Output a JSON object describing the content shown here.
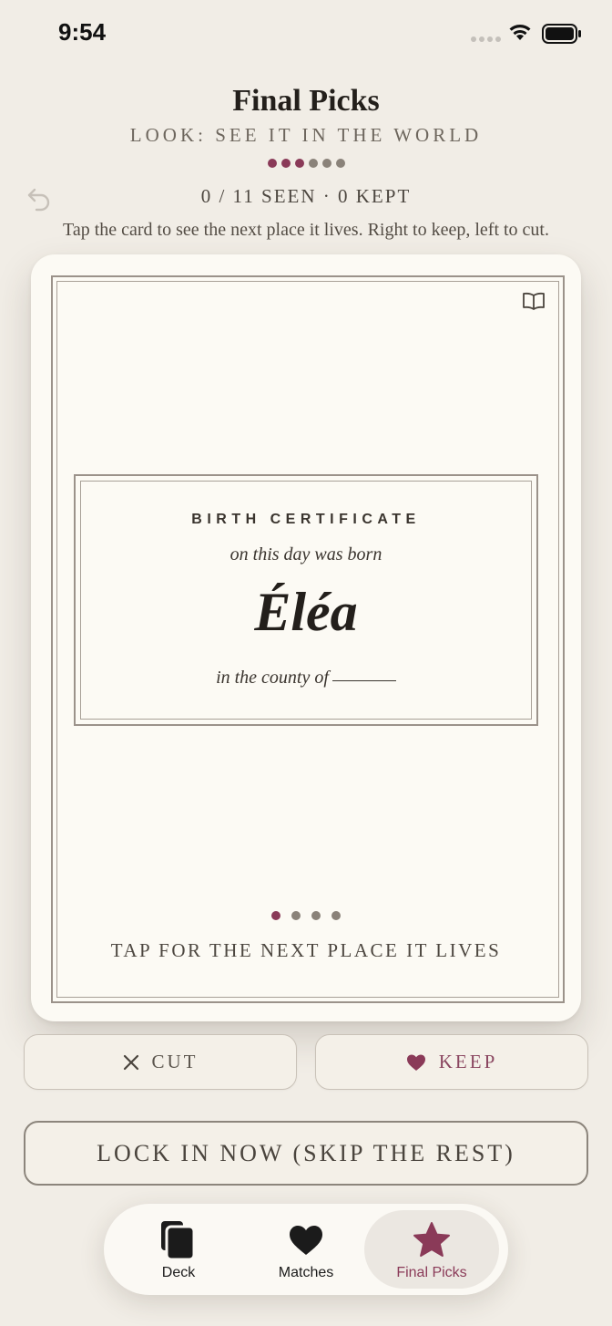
{
  "status_bar": {
    "time": "9:54"
  },
  "header": {
    "title": "Final Picks",
    "subtitle": "LOOK: SEE IT IN THE WORLD",
    "progress": {
      "total": 6,
      "completed": 3
    },
    "count": "0 / 11 SEEN · 0 KEPT",
    "hint": "Tap the card to see the next place it lives. Right to keep, left to cut."
  },
  "card": {
    "heading": "BIRTH CERTIFICATE",
    "born_line": "on this day was born",
    "name": "Éléa",
    "county_line": "in the county of",
    "place_dots": {
      "total": 4,
      "current": 1
    },
    "tap_hint": "TAP FOR THE NEXT PLACE IT LIVES"
  },
  "actions": {
    "cut_label": "CUT",
    "keep_label": "KEEP",
    "lock_label": "LOCK IN NOW (SKIP THE REST)"
  },
  "tab_bar": {
    "tabs": [
      {
        "label": "Deck",
        "icon": "cards-icon",
        "selected": false
      },
      {
        "label": "Matches",
        "icon": "heart-icon",
        "selected": false
      },
      {
        "label": "Final Picks",
        "icon": "star-icon",
        "selected": true
      }
    ]
  },
  "colors": {
    "background": "#f1ede6",
    "accent": "#8a3a58",
    "muted_dot": "#8a8279",
    "card": "#fcfaf4"
  }
}
